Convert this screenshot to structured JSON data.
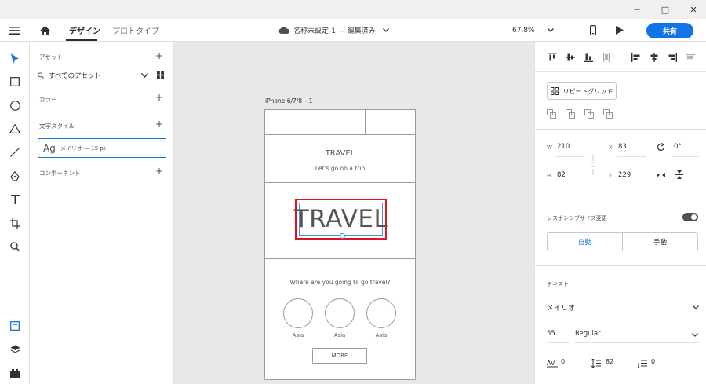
{
  "window": {
    "minimize": "─",
    "maximize": "□",
    "close": "✕"
  },
  "header": {
    "tab_design": "デザイン",
    "tab_prototype": "プロトタイプ",
    "doc_title": "名称未設定-1 — 編集済み",
    "zoom": "67.8%",
    "share_label": "共有"
  },
  "assets": {
    "section_assets": "アセット",
    "filter_label": "すべてのアセット",
    "section_colors": "カラー",
    "section_char_styles": "文字スタイル",
    "char_style_ag": "Ag",
    "char_style_text": "メイリオ — 15 pt",
    "section_components": "コンポーネント"
  },
  "artboard": {
    "label": "iPhone 6/7/8 – 1",
    "title": "TRAVEL",
    "subtitle": "Let's go on a trip",
    "hero_text": "TRAVEL",
    "question": "Where are you going to go travel?",
    "circles": [
      "Asia",
      "Asia",
      "Asia"
    ],
    "more": "MORE"
  },
  "props": {
    "repeat_grid": "リピートグリッド",
    "w_label": "W",
    "w_value": "210",
    "h_label": "H",
    "h_value": "82",
    "x_label": "X",
    "x_value": "83",
    "y_label": "Y",
    "y_value": "229",
    "rotation_value": "0°",
    "responsive_resize": "レスポンシブサイズ変更",
    "mode_auto": "自動",
    "mode_manual": "手動",
    "text_section": "テキスト",
    "font_family": "メイリオ",
    "font_size": "55",
    "font_weight": "Regular",
    "char_spacing": "0",
    "line_spacing": "82",
    "para_spacing": "0",
    "accent_color": "#1473e6",
    "selection_color": "#e0141e"
  }
}
